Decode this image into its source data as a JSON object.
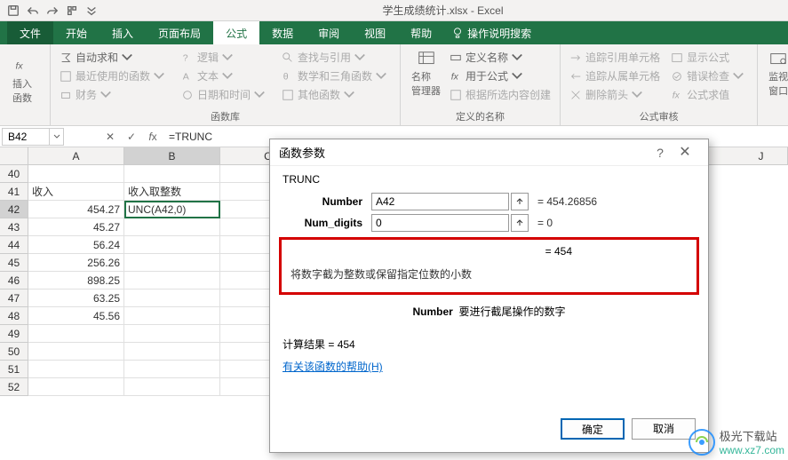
{
  "title": "学生成绩统计.xlsx - Excel",
  "tabs": {
    "file": "文件",
    "home": "开始",
    "insert": "插入",
    "layout": "页面布局",
    "formulas": "公式",
    "data": "数据",
    "review": "审阅",
    "view": "视图",
    "help": "帮助",
    "tellme": "操作说明搜索"
  },
  "ribbon": {
    "fx": "插入函数",
    "autosum": "自动求和",
    "recent": "最近使用的函数",
    "financial": "财务",
    "logical": "逻辑",
    "text": "文本",
    "datetime": "日期和时间",
    "lookup": "查找与引用",
    "math": "数学和三角函数",
    "other": "其他函数",
    "lib_label": "函数库",
    "name_mgr": "名称\n管理器",
    "define": "定义名称",
    "use": "用于公式",
    "create": "根据所选内容创建",
    "names_label": "定义的名称",
    "trace_prec": "追踪引用单元格",
    "trace_dep": "追踪从属单元格",
    "remove_arrows": "删除箭头",
    "show_formulas": "显示公式",
    "error_check": "错误检查",
    "eval": "公式求值",
    "audit_label": "公式审核",
    "watch": "监视窗口"
  },
  "namebox": "B42",
  "formula": "=TRUNC",
  "cols": [
    "A",
    "B",
    "C",
    "J"
  ],
  "rows": [
    {
      "n": "40",
      "a": "",
      "b": ""
    },
    {
      "n": "41",
      "a": "收入",
      "b": "收入取整数"
    },
    {
      "n": "42",
      "a": "454.27",
      "b": "UNC(A42,0)"
    },
    {
      "n": "43",
      "a": "45.27",
      "b": ""
    },
    {
      "n": "44",
      "a": "56.24",
      "b": ""
    },
    {
      "n": "45",
      "a": "256.26",
      "b": ""
    },
    {
      "n": "46",
      "a": "898.25",
      "b": ""
    },
    {
      "n": "47",
      "a": "63.25",
      "b": ""
    },
    {
      "n": "48",
      "a": "45.56",
      "b": ""
    },
    {
      "n": "49",
      "a": "",
      "b": ""
    },
    {
      "n": "50",
      "a": "",
      "b": ""
    },
    {
      "n": "51",
      "a": "",
      "b": ""
    },
    {
      "n": "52",
      "a": "",
      "b": ""
    }
  ],
  "dialog": {
    "title": "函数参数",
    "func": "TRUNC",
    "arg1_label": "Number",
    "arg1_value": "A42",
    "arg1_eval": "= 454.26856",
    "arg2_label": "Num_digits",
    "arg2_value": "0",
    "arg2_eval": "= 0",
    "result_eq": "= 454",
    "desc": "将数字截为整数或保留指定位数的小数",
    "arg_help_name": "Number",
    "arg_help_text": "要进行截尾操作的数字",
    "calc_result_label": "计算结果 = ",
    "calc_result": "454",
    "help_link": "有关该函数的帮助(H)",
    "ok": "确定",
    "cancel": "取消"
  },
  "watermark": {
    "t1": "极光下载站",
    "t2": "www.xz7.com"
  }
}
